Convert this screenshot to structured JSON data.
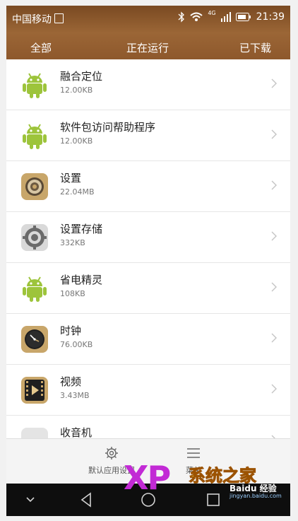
{
  "status_bar": {
    "carrier": "中国移动",
    "network": "4G",
    "time": "21:39"
  },
  "tabs": [
    {
      "label": "全部",
      "active": true
    },
    {
      "label": "正在运行",
      "active": false
    },
    {
      "label": "已下载",
      "active": false
    }
  ],
  "apps": [
    {
      "name": "融合定位",
      "size": "12.00KB",
      "icon": "android-icon"
    },
    {
      "name": "软件包访问帮助程序",
      "size": "12.00KB",
      "icon": "android-icon"
    },
    {
      "name": "设置",
      "size": "22.04MB",
      "icon": "settings-icon"
    },
    {
      "name": "设置存储",
      "size": "332KB",
      "icon": "gear-icon"
    },
    {
      "name": "省电精灵",
      "size": "108KB",
      "icon": "android-icon"
    },
    {
      "name": "时钟",
      "size": "76.00KB",
      "icon": "clock-icon"
    },
    {
      "name": "视频",
      "size": "3.43MB",
      "icon": "video-icon"
    },
    {
      "name": "收音机",
      "size": "",
      "icon": "radio-icon"
    }
  ],
  "toolbar": {
    "default_apps_label": "默认应用设置",
    "menu_label": "菜单"
  },
  "watermark": {
    "logo": "XP",
    "title": "系统之家",
    "baidu": "Baidu 经验",
    "url": "jingyan.baidu.com"
  },
  "colors": {
    "header_brown": "#8f5a2e",
    "android_green": "#9dc43b"
  }
}
